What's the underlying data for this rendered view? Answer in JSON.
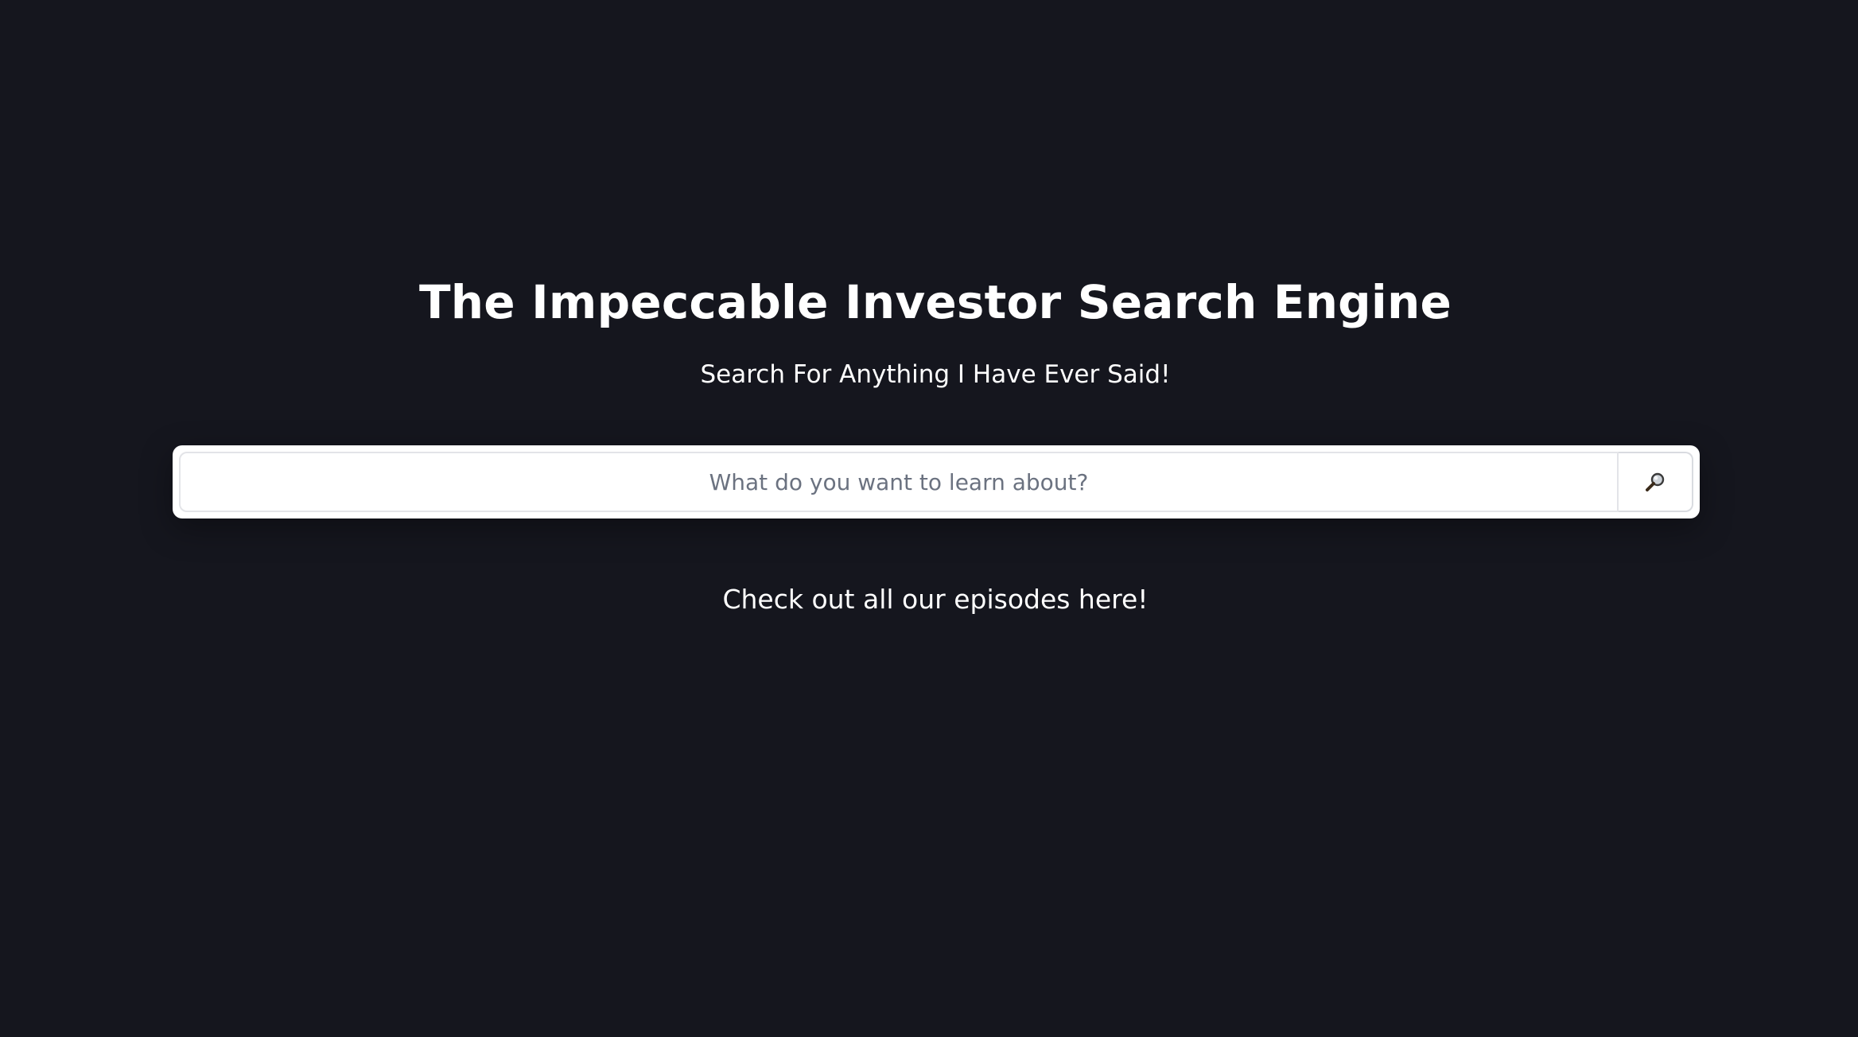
{
  "header": {
    "title": "The Impeccable Investor Search Engine",
    "subtitle": "Search For Anything I Have Ever Said!"
  },
  "search": {
    "placeholder": "What do you want to learn about?",
    "value": "",
    "button_icon": "magnifying-glass-icon"
  },
  "footer": {
    "episodes_link_label": "Check out all our episodes here!"
  },
  "colors": {
    "background": "#15161e",
    "text": "#ffffff",
    "search_bg": "#ffffff",
    "placeholder": "#6b7280"
  }
}
